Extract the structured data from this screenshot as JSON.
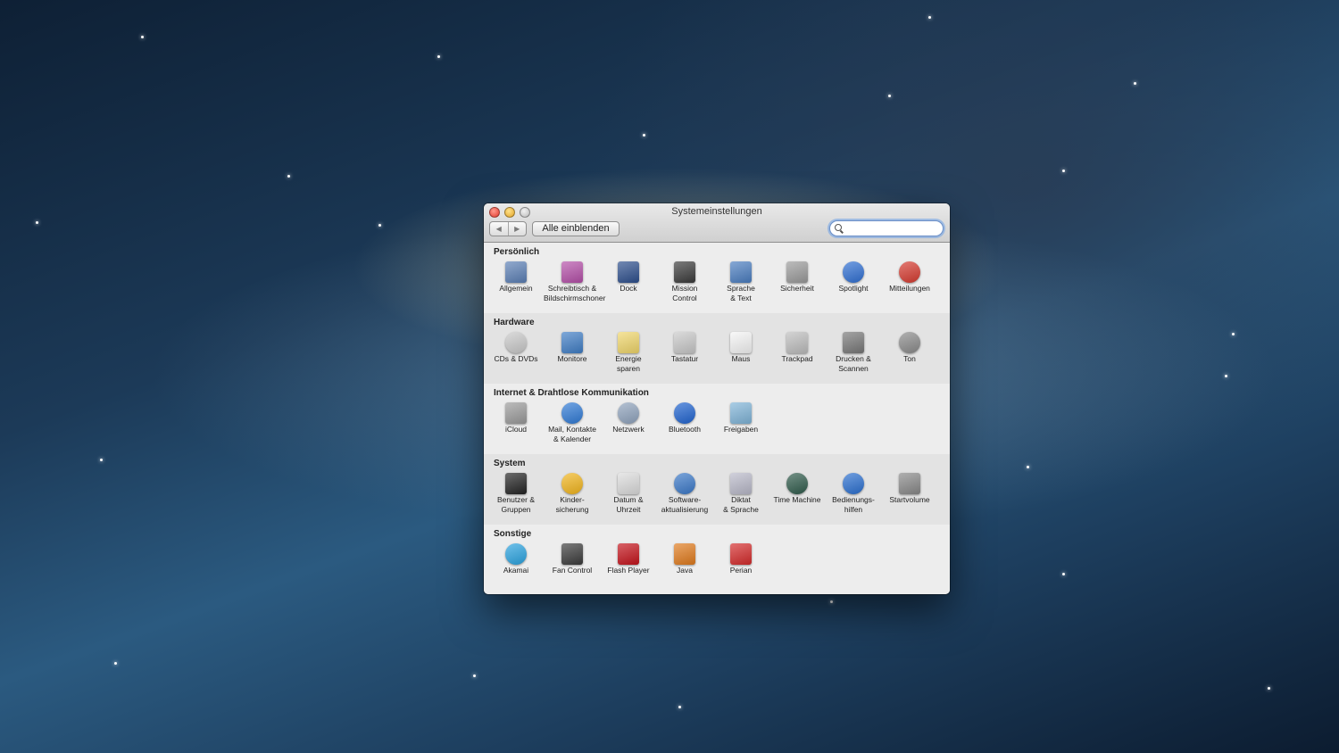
{
  "window": {
    "title": "Systemeinstellungen",
    "show_all_label": "Alle einblenden",
    "search_placeholder": "",
    "back_glyph": "◀",
    "forward_glyph": "▶"
  },
  "sections": [
    {
      "title": "Persönlich",
      "items": [
        {
          "label": "Allgemein",
          "icon": "general-icon",
          "color": "#5b7fb5"
        },
        {
          "label": "Schreibtisch &\nBildschirmschoner",
          "icon": "desktop-icon",
          "color": "#b44fa8"
        },
        {
          "label": "Dock",
          "icon": "dock-icon",
          "color": "#2c4e8c"
        },
        {
          "label": "Mission\nControl",
          "icon": "mission-control-icon",
          "color": "#3a3a3a"
        },
        {
          "label": "Sprache\n& Text",
          "icon": "language-icon",
          "color": "#4a7dc0"
        },
        {
          "label": "Sicherheit",
          "icon": "security-icon",
          "color": "#9a9a9a"
        },
        {
          "label": "Spotlight",
          "icon": "spotlight-icon",
          "color": "#2f6fd3"
        },
        {
          "label": "Mitteilungen",
          "icon": "notifications-icon",
          "color": "#d63a2f"
        }
      ]
    },
    {
      "title": "Hardware",
      "items": [
        {
          "label": "CDs & DVDs",
          "icon": "cd-dvd-icon",
          "color": "#c9c9c9"
        },
        {
          "label": "Monitore",
          "icon": "displays-icon",
          "color": "#3f7dc5"
        },
        {
          "label": "Energie\nsparen",
          "icon": "energy-saver-icon",
          "color": "#f0d66a"
        },
        {
          "label": "Tastatur",
          "icon": "keyboard-icon",
          "color": "#c8c8c8"
        },
        {
          "label": "Maus",
          "icon": "mouse-icon",
          "color": "#f5f5f5"
        },
        {
          "label": "Trackpad",
          "icon": "trackpad-icon",
          "color": "#bdbdbd"
        },
        {
          "label": "Drucken &\nScannen",
          "icon": "print-scan-icon",
          "color": "#777777"
        },
        {
          "label": "Ton",
          "icon": "sound-icon",
          "color": "#8a8a8a"
        }
      ]
    },
    {
      "title": "Internet & Drahtlose Kommunikation",
      "items": [
        {
          "label": "iCloud",
          "icon": "icloud-icon",
          "color": "#9a9a9a"
        },
        {
          "label": "Mail, Kontakte\n& Kalender",
          "icon": "mail-contacts-icon",
          "color": "#2f7ad6"
        },
        {
          "label": "Netzwerk",
          "icon": "network-icon",
          "color": "#8fa3bd"
        },
        {
          "label": "Bluetooth",
          "icon": "bluetooth-icon",
          "color": "#1f63d0"
        },
        {
          "label": "Freigaben",
          "icon": "sharing-icon",
          "color": "#7fb4d8"
        }
      ]
    },
    {
      "title": "System",
      "items": [
        {
          "label": "Benutzer &\nGruppen",
          "icon": "users-groups-icon",
          "color": "#222222"
        },
        {
          "label": "Kinder-\nsicherung",
          "icon": "parental-controls-icon",
          "color": "#f2b51c"
        },
        {
          "label": "Datum &\nUhrzeit",
          "icon": "date-time-icon",
          "color": "#dcdcdc"
        },
        {
          "label": "Software-\naktualisierung",
          "icon": "software-update-icon",
          "color": "#3a78c8"
        },
        {
          "label": "Diktat\n& Sprache",
          "icon": "dictation-icon",
          "color": "#b9b9c9"
        },
        {
          "label": "Time Machine",
          "icon": "time-machine-icon",
          "color": "#2e5a4a"
        },
        {
          "label": "Bedienungs-\nhilfen",
          "icon": "accessibility-icon",
          "color": "#2a6fd0"
        },
        {
          "label": "Startvolume",
          "icon": "startup-disk-icon",
          "color": "#888888"
        }
      ]
    },
    {
      "title": "Sonstige",
      "items": [
        {
          "label": "Akamai",
          "icon": "akamai-icon",
          "color": "#2aa3e0"
        },
        {
          "label": "Fan Control",
          "icon": "fan-control-icon",
          "color": "#3a3a3a"
        },
        {
          "label": "Flash Player",
          "icon": "flash-player-icon",
          "color": "#c4121a"
        },
        {
          "label": "Java",
          "icon": "java-icon",
          "color": "#e07a1c"
        },
        {
          "label": "Perian",
          "icon": "perian-icon",
          "color": "#d42a2a"
        }
      ]
    }
  ]
}
